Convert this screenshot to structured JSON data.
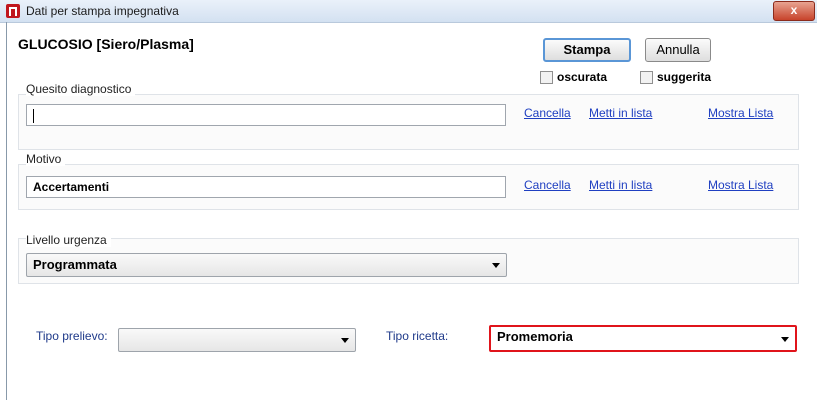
{
  "window": {
    "title": "Dati per stampa impegnativa",
    "close_glyph": "x"
  },
  "header": {
    "exam_title": "GLUCOSIO [Siero/Plasma]"
  },
  "actions": {
    "print_label": "Stampa",
    "cancel_label": "Annulla",
    "checkbox_oscurata": {
      "label": "oscurata",
      "checked": false
    },
    "checkbox_suggerita": {
      "label": "suggerita",
      "checked": false
    }
  },
  "quesito": {
    "label": "Quesito diagnostico",
    "value": "",
    "links": {
      "cancella": "Cancella",
      "metti_in_lista": "Metti in lista",
      "mostra_lista": "Mostra Lista"
    }
  },
  "motivo": {
    "label": "Motivo",
    "value": "Accertamenti",
    "links": {
      "cancella": "Cancella",
      "metti_in_lista": "Metti in lista",
      "mostra_lista": "Mostra Lista"
    }
  },
  "urgenza": {
    "label": "Livello urgenza",
    "selected": "Programmata"
  },
  "prelievo": {
    "label": "Tipo prelievo:",
    "selected": ""
  },
  "ricetta": {
    "label": "Tipo ricetta:",
    "selected": "Promemoria",
    "highlight_color": "#e0141b"
  },
  "icons": {
    "app": "app-logo-icon",
    "dropdown": "chevron-down-icon"
  }
}
